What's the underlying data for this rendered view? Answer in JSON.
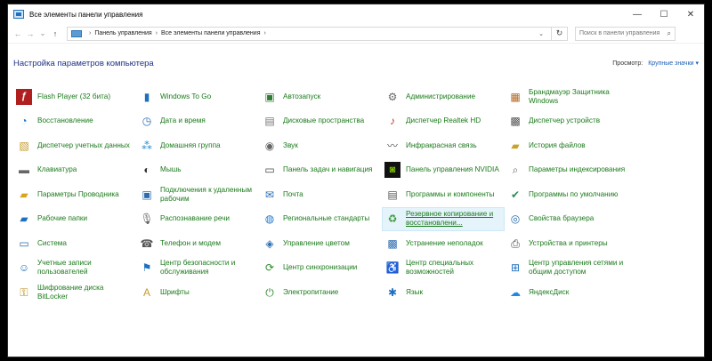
{
  "window": {
    "title": "Все элементы панели управления"
  },
  "controls": {
    "minimize": "—",
    "maximize": "☐",
    "close": "✕"
  },
  "address": {
    "crumbs": [
      "Панель управления",
      "Все элементы панели управления"
    ],
    "search_placeholder": "Поиск в панели управления"
  },
  "header": {
    "title": "Настройка параметров компьютера",
    "view_label": "Просмотр:",
    "view_value": "Крупные значки ▾"
  },
  "items": [
    {
      "label": "Flash Player (32 бита)",
      "icon": "flash-icon"
    },
    {
      "label": "Windows To Go",
      "icon": "usb-icon"
    },
    {
      "label": "Автозапуск",
      "icon": "autoplay-icon"
    },
    {
      "label": "Администрирование",
      "icon": "admin-tools-icon"
    },
    {
      "label": "Брандмауэр Защитника Windows",
      "icon": "firewall-icon"
    },
    {
      "label": "Восстановление",
      "icon": "recovery-icon"
    },
    {
      "label": "Дата и время",
      "icon": "clock-icon"
    },
    {
      "label": "Дисковые пространства",
      "icon": "storage-spaces-icon"
    },
    {
      "label": "Диспетчер Realtek HD",
      "icon": "audio-manager-icon"
    },
    {
      "label": "Диспетчер устройств",
      "icon": "device-manager-icon"
    },
    {
      "label": "Диспетчер учетных данных",
      "icon": "credential-icon"
    },
    {
      "label": "Домашняя группа",
      "icon": "homegroup-icon"
    },
    {
      "label": "Звук",
      "icon": "speaker-icon"
    },
    {
      "label": "Инфракрасная связь",
      "icon": "infrared-icon"
    },
    {
      "label": "История файлов",
      "icon": "file-history-icon"
    },
    {
      "label": "Клавиатура",
      "icon": "keyboard-icon"
    },
    {
      "label": "Мышь",
      "icon": "mouse-icon"
    },
    {
      "label": "Панель задач и навигация",
      "icon": "taskbar-icon"
    },
    {
      "label": "Панель управления NVIDIA",
      "icon": "nvidia-icon"
    },
    {
      "label": "Параметры индексирования",
      "icon": "indexing-icon"
    },
    {
      "label": "Параметры Проводника",
      "icon": "folder-options-icon"
    },
    {
      "label": "Подключения к удаленным рабочим",
      "icon": "remote-desktop-icon"
    },
    {
      "label": "Почта",
      "icon": "mail-icon"
    },
    {
      "label": "Программы и компоненты",
      "icon": "programs-icon"
    },
    {
      "label": "Программы по умолчанию",
      "icon": "default-programs-icon"
    },
    {
      "label": "Рабочие папки",
      "icon": "work-folders-icon"
    },
    {
      "label": "Распознавание речи",
      "icon": "microphone-icon"
    },
    {
      "label": "Региональные стандарты",
      "icon": "globe-clock-icon"
    },
    {
      "label": "Резервное копирование и восстановлени...",
      "icon": "backup-icon"
    },
    {
      "label": "Свойства браузера",
      "icon": "internet-options-icon"
    },
    {
      "label": "Система",
      "icon": "system-icon"
    },
    {
      "label": "Телефон и модем",
      "icon": "phone-icon"
    },
    {
      "label": "Управление цветом",
      "icon": "color-management-icon"
    },
    {
      "label": "Устранение неполадок",
      "icon": "troubleshoot-icon"
    },
    {
      "label": "Устройства и принтеры",
      "icon": "printer-icon"
    },
    {
      "label": "Учетные записи пользователей",
      "icon": "users-icon"
    },
    {
      "label": "Центр безопасности и обслуживания",
      "icon": "flag-icon"
    },
    {
      "label": "Центр синхронизации",
      "icon": "sync-icon"
    },
    {
      "label": "Центр специальных возможностей",
      "icon": "accessibility-icon"
    },
    {
      "label": "Центр управления сетями и общим доступом",
      "icon": "network-icon"
    },
    {
      "label": "Шифрование диска BitLocker",
      "icon": "bitlocker-icon"
    },
    {
      "label": "Шрифты",
      "icon": "fonts-icon"
    },
    {
      "label": "Электропитание",
      "icon": "power-icon"
    },
    {
      "label": "Язык",
      "icon": "language-icon"
    },
    {
      "label": "ЯндексДиск",
      "icon": "yandex-disk-icon"
    }
  ],
  "hovered_index": 28
}
